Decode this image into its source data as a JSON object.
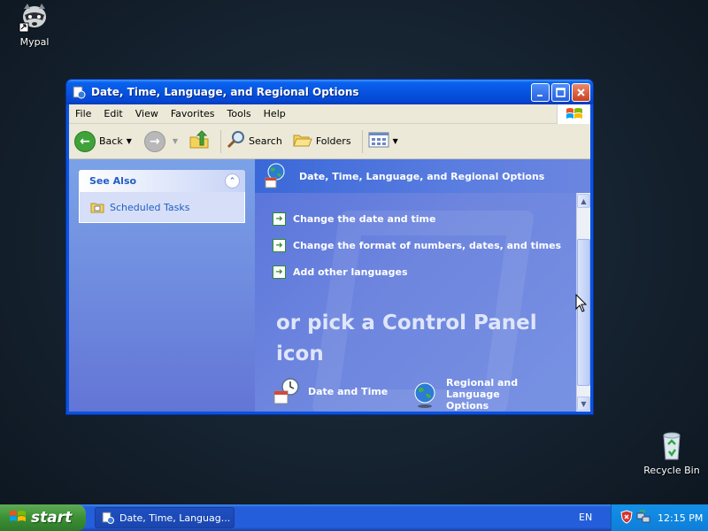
{
  "desktop": {
    "icons": [
      {
        "label": "Mypal"
      },
      {
        "label": "Recycle Bin"
      }
    ]
  },
  "window": {
    "title": "Date, Time, Language, and Regional Options",
    "menu": [
      "File",
      "Edit",
      "View",
      "Favorites",
      "Tools",
      "Help"
    ],
    "toolbar": {
      "back_label": "Back",
      "search_label": "Search",
      "folders_label": "Folders"
    },
    "sidebar": {
      "see_also_title": "See Also",
      "items": [
        {
          "label": "Scheduled Tasks"
        }
      ]
    },
    "main": {
      "header_title": "Date, Time, Language, and Regional Options",
      "tasks": [
        {
          "label": "Change the date and time"
        },
        {
          "label": "Change the format of numbers, dates, and times"
        },
        {
          "label": "Add other languages"
        }
      ],
      "pick_heading": "or pick a Control Panel icon",
      "icons": [
        {
          "label": "Date and Time"
        },
        {
          "label": "Regional and Language Options"
        }
      ]
    }
  },
  "taskbar": {
    "start_label": "start",
    "task_button_label": "Date, Time, Languag...",
    "language": "EN",
    "clock": "12:15 PM"
  },
  "colors": {
    "titlebar": "#0654e0",
    "sidebar_bg": "#7ba2e7",
    "content_bg": "#6980d9",
    "taskbar": "#245edb",
    "start_button": "#3c8f35",
    "tray": "#0f7ed8"
  }
}
